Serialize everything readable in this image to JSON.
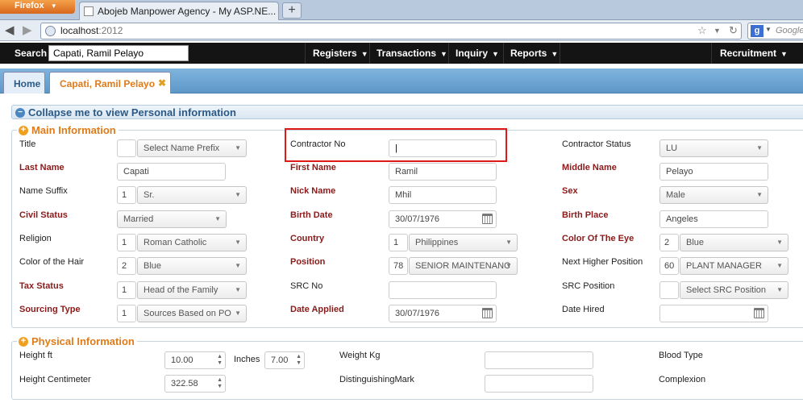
{
  "browser": {
    "app_button": "Firefox",
    "tab_title": "Abojeb Manpower Agency - My ASP.NE...",
    "url_host": "localhost",
    "url_port": ":2012",
    "search_engine_placeholder": "Google"
  },
  "header": {
    "search_label": "Search",
    "search_value": "Capati, Ramil Pelayo",
    "menus": [
      "Registers",
      "Transactions",
      "Inquiry",
      "Reports",
      "Recruitment"
    ]
  },
  "tabs": {
    "home": "Home",
    "current": "Capati, Ramil Pelayo"
  },
  "collapse_bar": "Collapse me to view Personal information",
  "main": {
    "legend": "Main Information",
    "title": {
      "label": "Title",
      "code": "",
      "value": "Select Name Prefix"
    },
    "contractor_no": {
      "label": "Contractor No",
      "value": "|"
    },
    "contractor_status": {
      "label": "Contractor Status",
      "value": "LU"
    },
    "last_name": {
      "label": "Last Name",
      "value": "Capati"
    },
    "first_name": {
      "label": "First Name",
      "value": "Ramil"
    },
    "middle_name": {
      "label": "Middle Name",
      "value": "Pelayo"
    },
    "name_suffix": {
      "label": "Name Suffix",
      "code": "1",
      "value": "Sr."
    },
    "nick_name": {
      "label": "Nick Name",
      "value": "Mhil"
    },
    "sex": {
      "label": "Sex",
      "value": "Male"
    },
    "civil_status": {
      "label": "Civil Status",
      "value": "Married"
    },
    "birth_date": {
      "label": "Birth Date",
      "value": "30/07/1976"
    },
    "birth_place": {
      "label": "Birth Place",
      "value": "Angeles"
    },
    "religion": {
      "label": "Religion",
      "code": "1",
      "value": "Roman Catholic"
    },
    "country": {
      "label": "Country",
      "code": "1",
      "value": "Philippines"
    },
    "eye_color": {
      "label": "Color Of The Eye",
      "code": "2",
      "value": "Blue"
    },
    "hair_color": {
      "label": "Color of the Hair",
      "code": "2",
      "value": "Blue"
    },
    "position": {
      "label": "Position",
      "code": "78",
      "value": "SENIOR MAINTENANC"
    },
    "next_position": {
      "label": "Next Higher Position",
      "code": "60",
      "value": "PLANT MANAGER"
    },
    "tax_status": {
      "label": "Tax Status",
      "code": "1",
      "value": "Head of the Family"
    },
    "src_no": {
      "label": "SRC No",
      "value": ""
    },
    "src_position": {
      "label": "SRC Position",
      "code": "",
      "value": "Select SRC Position"
    },
    "sourcing_type": {
      "label": "Sourcing Type",
      "code": "1",
      "value": "Sources Based on PO"
    },
    "date_applied": {
      "label": "Date Applied",
      "value": "30/07/1976"
    },
    "date_hired": {
      "label": "Date Hired",
      "value": ""
    }
  },
  "physical": {
    "legend": "Physical Information",
    "height_ft": {
      "label": "Height ft",
      "value": "10.00"
    },
    "inches": {
      "label": "Inches",
      "value": "7.00"
    },
    "weight": {
      "label": "Weight Kg",
      "value": ""
    },
    "blood_type": {
      "label": "Blood Type"
    },
    "height_cm": {
      "label": "Height Centimeter",
      "value": "322.58"
    },
    "mark": {
      "label": "DistinguishingMark",
      "value": ""
    },
    "complexion": {
      "label": "Complexion"
    }
  }
}
